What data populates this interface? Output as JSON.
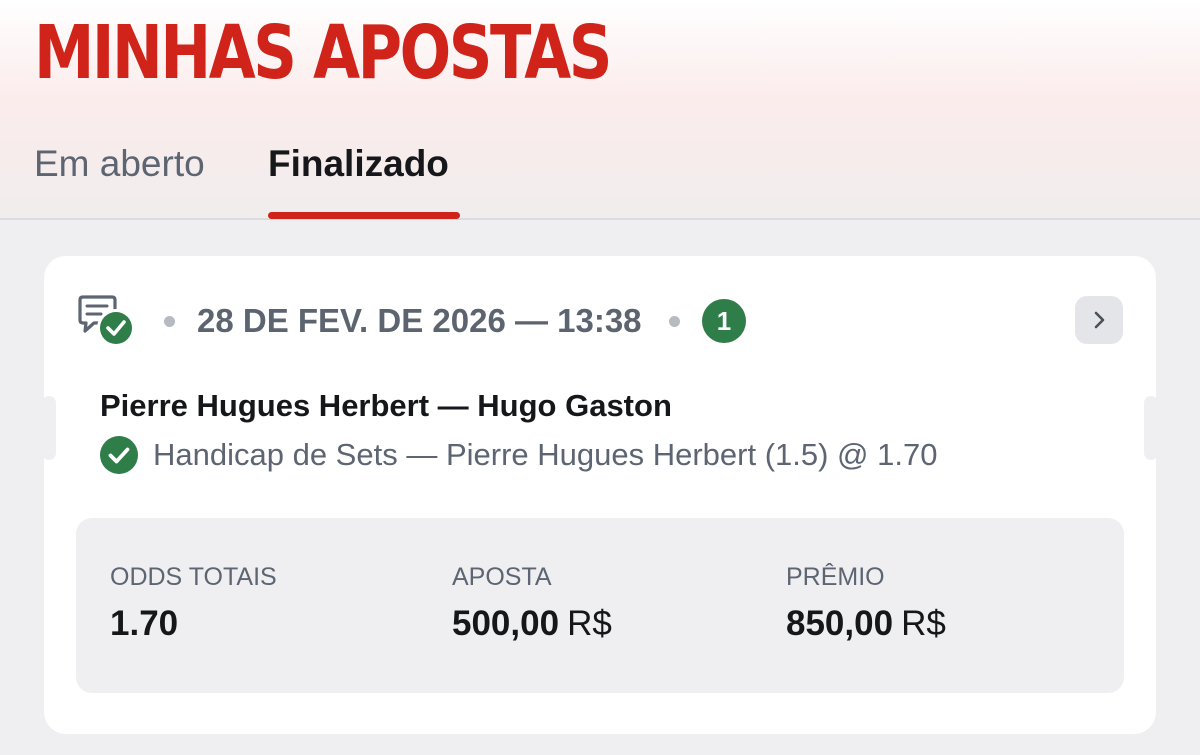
{
  "page": {
    "title": "MINHAS APOSTAS"
  },
  "tabs": [
    {
      "label": "Em aberto",
      "active": false
    },
    {
      "label": "Finalizado",
      "active": true
    }
  ],
  "bet": {
    "status_icon": "ticket-check-icon",
    "datetime": "28 DE FEV. DE 2026 — 13:38",
    "selections_count": "1",
    "match": "Pierre Hugues Herbert — Hugo Gaston",
    "selection": "Handicap de Sets — Pierre Hugues Herbert (1.5) @ 1.70",
    "selection_status_icon": "check-circle-icon",
    "summary": {
      "odds_label": "ODDS TOTAIS",
      "odds_value": "1.70",
      "stake_label": "APOSTA",
      "stake_value": "500,00",
      "stake_currency": "R$",
      "prize_label": "PRÊMIO",
      "prize_value": "850,00",
      "prize_currency": "R$"
    }
  },
  "colors": {
    "accent": "#d0241b",
    "success": "#2f7d48",
    "text": "#15171a",
    "muted": "#5d6572"
  }
}
